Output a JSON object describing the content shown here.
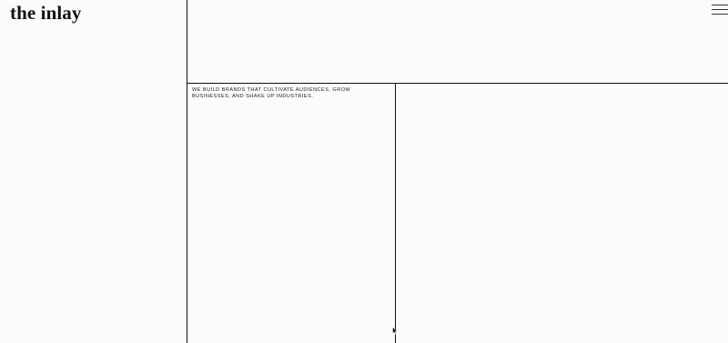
{
  "header": {
    "logo_text": "the inlay",
    "menu_icon": "hamburger-icon"
  },
  "main": {
    "tagline": "WE BUILD BRANDS THAT CULTIVATE AUDIENCES, GROW BUSINESSES, AND SHAKE UP INDUSTRIES."
  },
  "colors": {
    "background": "#fbfbfb",
    "lines": "#111111",
    "text": "#111111"
  }
}
